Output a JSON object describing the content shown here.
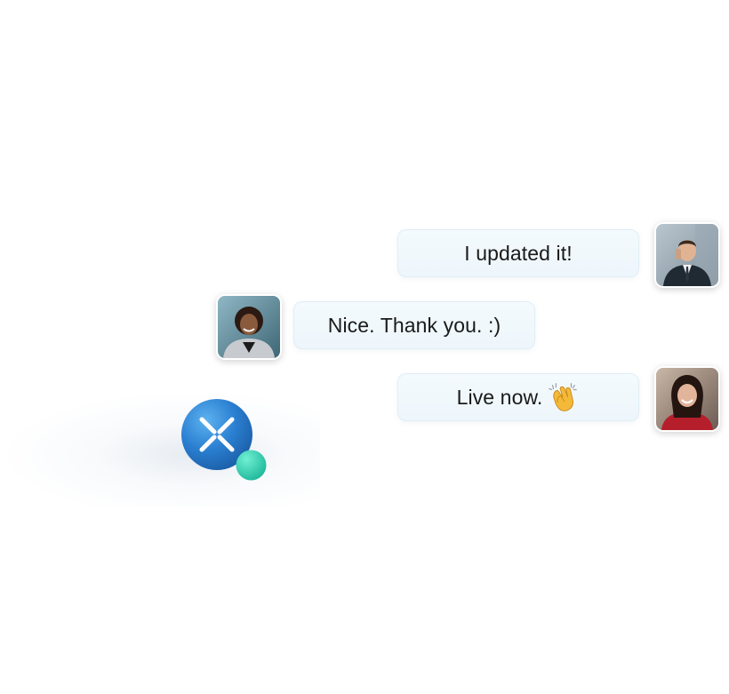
{
  "messages": [
    {
      "text": "I updated it!",
      "side": "right",
      "avatar": "businessman-avatar"
    },
    {
      "text": "Nice. Thank you. :)",
      "side": "left",
      "avatar": "woman-curly-hair-avatar"
    },
    {
      "text": "Live now.",
      "side": "right",
      "avatar": "woman-smiling-avatar",
      "emoji": "clapping-hands-icon"
    }
  ],
  "colors": {
    "bubble_bg": "#eef7fb",
    "bubble_border": "#e1eef5",
    "text": "#1a1a1a",
    "logo_blue": "#2a7fd1",
    "dot_teal": "#2fd0b0"
  },
  "logo": {
    "icon": "x-logo-sphere-icon"
  }
}
